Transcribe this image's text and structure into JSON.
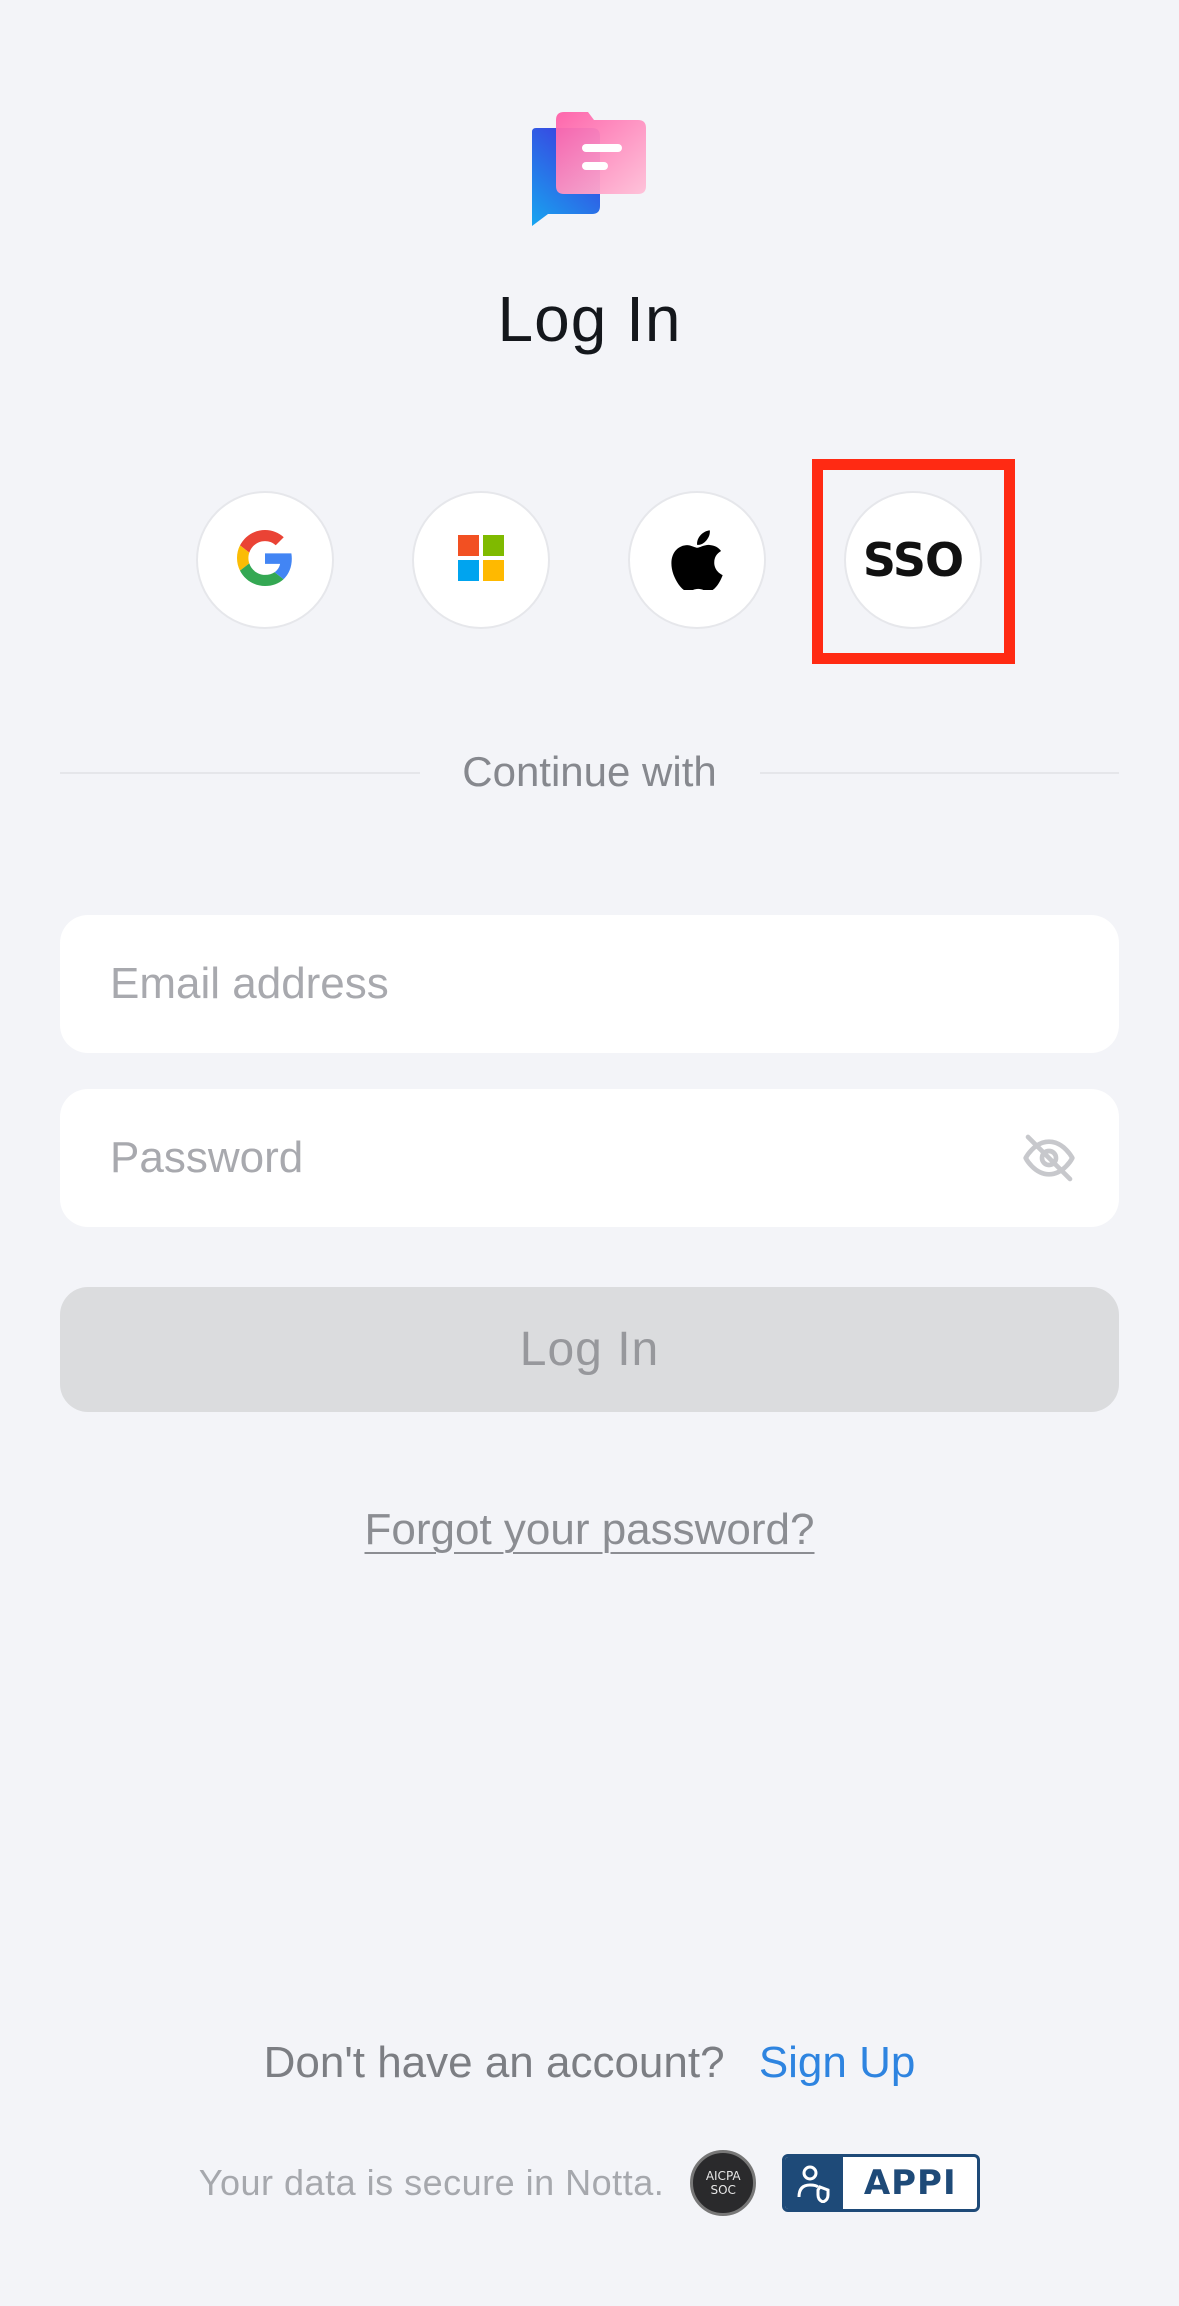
{
  "app": {
    "title": "Log In"
  },
  "social_login": {
    "buttons": [
      {
        "icon": "google-icon"
      },
      {
        "icon": "microsoft-icon"
      },
      {
        "icon": "apple-icon"
      },
      {
        "label": "SSO"
      }
    ],
    "highlight_color": "#ff2a13"
  },
  "divider": {
    "label": "Continue with"
  },
  "form": {
    "email_placeholder": "Email address",
    "password_placeholder": "Password",
    "password_toggle_icon": "eye-off-icon",
    "submit_label": "Log In",
    "forgot_label": "Forgot your password?"
  },
  "footer": {
    "signup_prompt": "Don't have an account?",
    "signup_label": "Sign Up",
    "secure_text": "Your data is secure in Notta.",
    "badge_aicpa_line1": "AICPA",
    "badge_aicpa_line2": "SOC",
    "badge_appi_label": "APPI"
  },
  "colors": {
    "background": "#f3f4f8",
    "link": "#2e84e0",
    "badge_blue": "#1e4a78"
  }
}
